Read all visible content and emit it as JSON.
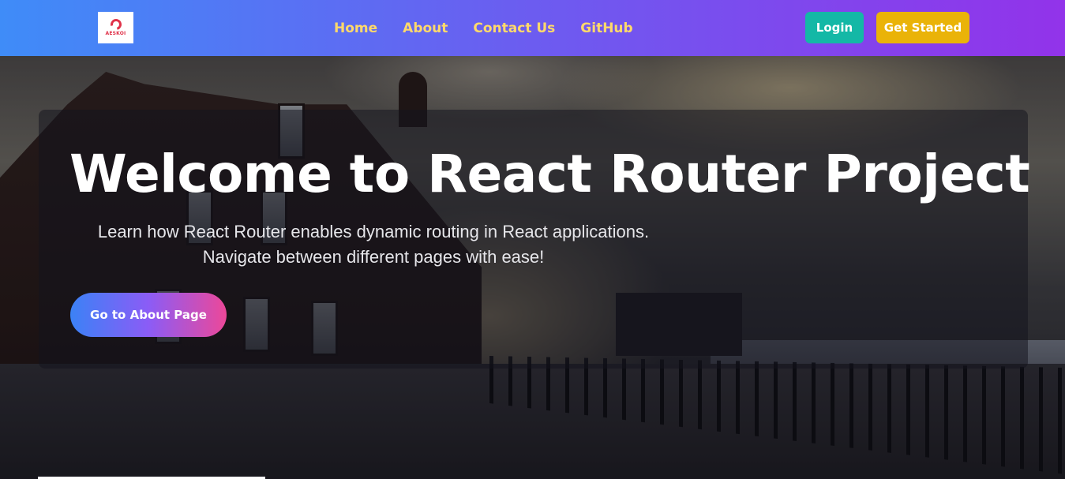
{
  "navbar": {
    "logo_text": "AESKOI",
    "links": [
      "Home",
      "About",
      "Contact Us",
      "GitHub"
    ],
    "login_label": "Login",
    "get_started_label": "Get Started"
  },
  "hero": {
    "title": "Welcome to React Router Project",
    "subtitle": "Learn how React Router enables dynamic routing in React applications. Navigate between different pages with ease!",
    "cta_label": "Go to About Page"
  },
  "colors": {
    "nav_gradient_start": "#3f8cf8",
    "nav_gradient_end": "#9233ea",
    "nav_link": "#ffd96b",
    "login_button": "#14b8a6",
    "get_started_button": "#eab308",
    "cta_gradient_start": "#3b82f6",
    "cta_gradient_end": "#ec4899"
  }
}
